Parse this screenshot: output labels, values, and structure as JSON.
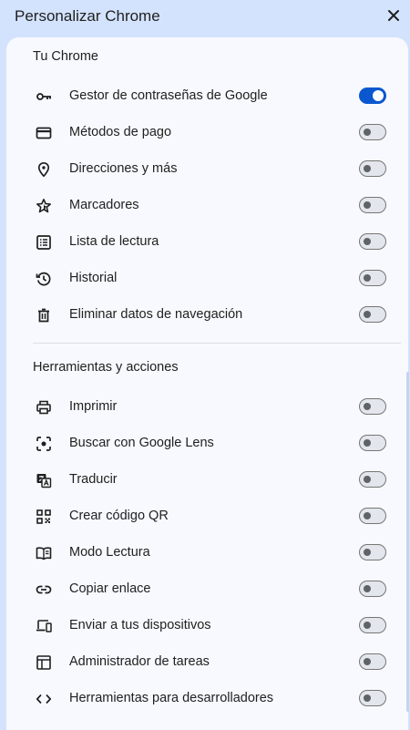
{
  "header": {
    "title": "Personalizar Chrome"
  },
  "sections": [
    {
      "title": "Tu Chrome",
      "items": [
        {
          "label": "Gestor de contraseñas de Google",
          "icon": "key-icon",
          "enabled": true
        },
        {
          "label": "Métodos de pago",
          "icon": "credit-card-icon",
          "enabled": false
        },
        {
          "label": "Direcciones y más",
          "icon": "location-pin-icon",
          "enabled": false
        },
        {
          "label": "Marcadores",
          "icon": "star-icon",
          "enabled": false
        },
        {
          "label": "Lista de lectura",
          "icon": "reading-list-icon",
          "enabled": false
        },
        {
          "label": "Historial",
          "icon": "history-icon",
          "enabled": false
        },
        {
          "label": "Eliminar datos de navegación",
          "icon": "trash-icon",
          "enabled": false
        }
      ]
    },
    {
      "title": "Herramientas y acciones",
      "items": [
        {
          "label": "Imprimir",
          "icon": "printer-icon",
          "enabled": false
        },
        {
          "label": "Buscar con Google Lens",
          "icon": "lens-icon",
          "enabled": false
        },
        {
          "label": "Traducir",
          "icon": "translate-icon",
          "enabled": false
        },
        {
          "label": "Crear código QR",
          "icon": "qr-code-icon",
          "enabled": false
        },
        {
          "label": "Modo Lectura",
          "icon": "book-icon",
          "enabled": false
        },
        {
          "label": "Copiar enlace",
          "icon": "link-icon",
          "enabled": false
        },
        {
          "label": "Enviar a tus dispositivos",
          "icon": "devices-icon",
          "enabled": false
        },
        {
          "label": "Administrador de tareas",
          "icon": "task-manager-icon",
          "enabled": false
        },
        {
          "label": "Herramientas para desarrolladores",
          "icon": "code-icon",
          "enabled": false
        }
      ]
    }
  ],
  "colors": {
    "accent": "#0b57d0",
    "background": "#d3e3fd",
    "panel": "#f8f9fe"
  }
}
